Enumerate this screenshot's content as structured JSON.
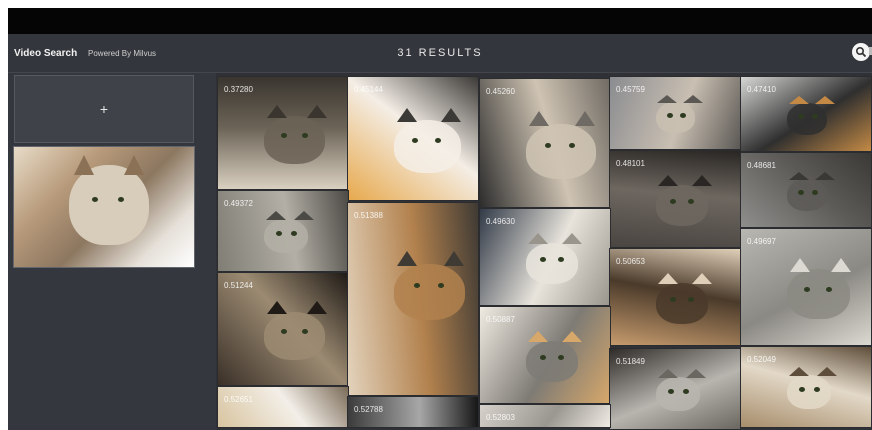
{
  "header": {
    "app_title": "Video Search",
    "subtitle": "Powered By Milvus",
    "results_label": "31 RESULTS"
  },
  "sidebar": {
    "upload_symbol": "+"
  },
  "results": [
    {
      "score": "0.37280",
      "colors": [
        "#d9d0c0",
        "#6b6356",
        "#3a352f"
      ]
    },
    {
      "score": "0.45144",
      "colors": [
        "#e7a94d",
        "#f4eee6",
        "#3c3a37"
      ]
    },
    {
      "score": "0.45260",
      "colors": [
        "#2c2c2c",
        "#cfc4b3",
        "#6f6a63"
      ]
    },
    {
      "score": "0.45759",
      "colors": [
        "#8a8c90",
        "#c9bfb2",
        "#5b5854"
      ]
    },
    {
      "score": "0.47410",
      "colors": [
        "#d7d7d5",
        "#2f2f2f",
        "#c48a45"
      ]
    },
    {
      "score": "0.48101",
      "colors": [
        "#4a4541",
        "#6e6760",
        "#292623"
      ]
    },
    {
      "score": "0.48681",
      "colors": [
        "#8e8e8c",
        "#5d5b57",
        "#3b3936"
      ]
    },
    {
      "score": "0.49372",
      "colors": [
        "#7f7d74",
        "#b3afa6",
        "#4c4a45"
      ]
    },
    {
      "score": "0.49630",
      "colors": [
        "#313a47",
        "#e8e4dc",
        "#9a958c"
      ]
    },
    {
      "score": "0.49697",
      "colors": [
        "#b9b7b1",
        "#8b8983",
        "#dcd9d2"
      ]
    },
    {
      "score": "0.50653",
      "colors": [
        "#c69b6d",
        "#4a3a2a",
        "#e0cfb8"
      ]
    },
    {
      "score": "0.51244",
      "colors": [
        "#3a3028",
        "#9c8b72",
        "#1f1a16"
      ]
    },
    {
      "score": "0.51388",
      "colors": [
        "#e3d3bd",
        "#b2814d",
        "#3f3a34"
      ]
    },
    {
      "score": "0.50887",
      "colors": [
        "#f0ebe2",
        "#7e7b75",
        "#d7a86a"
      ]
    },
    {
      "score": "0.51849",
      "colors": [
        "#2f2c29",
        "#b8b5af",
        "#6a6660"
      ]
    },
    {
      "score": "0.52049",
      "colors": [
        "#a78d6b",
        "#e3d9c8",
        "#5e4d3a"
      ]
    },
    {
      "score": "0.52651",
      "colors": [
        "#d8c49f",
        "#f3efe8",
        "#7b6b58"
      ]
    },
    {
      "score": "0.52788",
      "colors": [
        "#3b3b3b",
        "#a7a7a7",
        "#161616"
      ]
    },
    {
      "score": "0.52803",
      "colors": [
        "#d6d2cb",
        "#9a9791",
        "#f0ece4"
      ]
    }
  ]
}
